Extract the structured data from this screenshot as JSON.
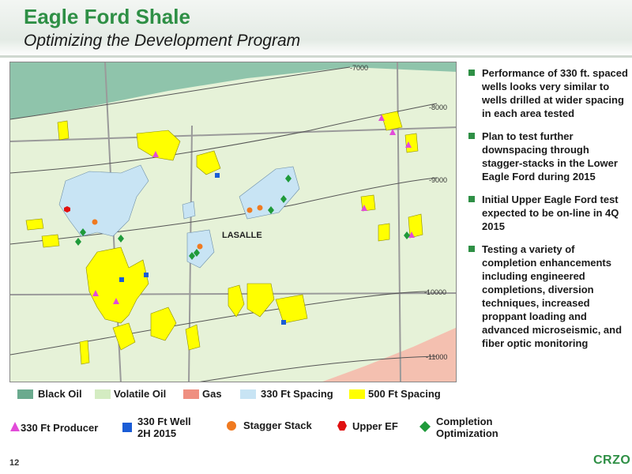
{
  "header": {
    "title": "Eagle Ford Shale",
    "subtitle": "Optimizing the Development Program"
  },
  "map": {
    "county_label": "LASALLE",
    "contours": [
      "-7000",
      "-8000",
      "-9000",
      "-10000",
      "-11000"
    ],
    "colors": {
      "black_oil": "#6aaa8e",
      "volatile_oil": "#e6f2d8",
      "gas": "#f2b2a3",
      "spacing_330": "#c8e4f4",
      "spacing_500": "#ffff00",
      "producer_330": "#e24bd9",
      "well_2h_2015": "#1a5cd6",
      "stagger_stack": "#f07a20",
      "upper_ef": "#e01010",
      "completion_opt": "#1f9a3a"
    }
  },
  "bullets": [
    "Performance of 330 ft. spaced wells looks very similar to wells drilled at wider spacing in each area tested",
    "Plan to test further downspacing through stagger-stacks in the Lower Eagle Ford during 2015",
    "Initial Upper Eagle Ford test expected to be on-line in 4Q 2015",
    "Testing a variety of completion enhancements including engineered completions, diversion techniques, increased proppant loading and advanced microseismic, and fiber optic monitoring"
  ],
  "legend_areas": [
    {
      "label": "Black Oil",
      "color": "#6aaa8e"
    },
    {
      "label": "Volatile Oil",
      "color": "#d4ecc2"
    },
    {
      "label": "Gas",
      "color": "#ef8f80"
    },
    {
      "label": "330 Ft Spacing",
      "color": "#c8e4f4"
    },
    {
      "label": "500 Ft Spacing",
      "color": "#ffff00"
    }
  ],
  "legend_symbols": [
    {
      "label": "330 Ft Producer",
      "icon": "triangle",
      "color": "#e24bd9"
    },
    {
      "label_line1": "330 Ft Well",
      "label_line2": "2H 2015",
      "icon": "square",
      "color": "#1a5cd6"
    },
    {
      "label": "Stagger Stack",
      "icon": "circle",
      "color": "#f07a20"
    },
    {
      "label": "Upper EF",
      "icon": "hexagon",
      "color": "#e01010"
    },
    {
      "label_line1": "Completion",
      "label_line2": "Optimization",
      "icon": "diamond",
      "color": "#1f9a3a"
    }
  ],
  "footer": {
    "page_number": "12",
    "logo": "CRZO"
  }
}
